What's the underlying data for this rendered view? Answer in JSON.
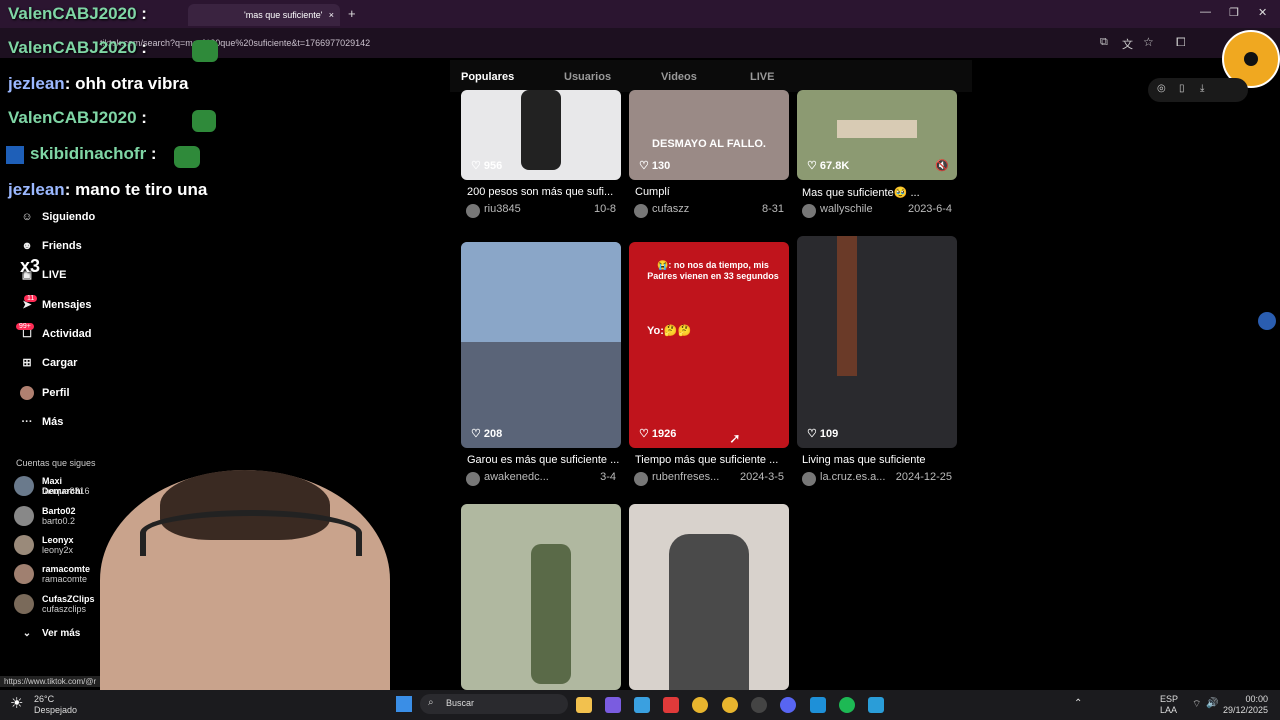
{
  "browser": {
    "tab_title": "'mas que suficiente'",
    "url": "tiktok.com/search?q=mas%20que%20suficiente&t=1766977029142",
    "new_tab": "+",
    "close": "×"
  },
  "tabs": [
    {
      "label": "Populares",
      "active": true
    },
    {
      "label": "Usuarios",
      "active": false
    },
    {
      "label": "Videos",
      "active": false
    },
    {
      "label": "LIVE",
      "active": false
    }
  ],
  "sidebar": {
    "items": [
      {
        "label": "Siguiendo",
        "icon": "people-icon"
      },
      {
        "label": "Friends",
        "icon": "friends-icon"
      },
      {
        "label": "LIVE",
        "icon": "live-icon"
      },
      {
        "label": "Mensajes",
        "icon": "send-icon",
        "badge": "11"
      },
      {
        "label": "Actividad",
        "icon": "inbox-icon",
        "badge": "99+"
      },
      {
        "label": "Cargar",
        "icon": "upload-icon"
      },
      {
        "label": "Perfil",
        "icon": "avatar"
      },
      {
        "label": "Más",
        "icon": "more-icon"
      }
    ],
    "following_title": "Cuentas que sigues",
    "following": [
      {
        "name": "Maxi Demarchi",
        "handle": "tanque8316",
        "color": "#6a7a8c"
      },
      {
        "name": "Barto02",
        "handle": "barto0.2",
        "color": "#888"
      },
      {
        "name": "Leonyx",
        "handle": "leony2x",
        "color": "#9a8a7a"
      },
      {
        "name": "ramacomte",
        "handle": "ramacomte",
        "color": "#a08070"
      },
      {
        "name": "CufasZClips",
        "handle": "cufaszclips",
        "color": "#7a6a5a"
      }
    ],
    "see_more": "Ver más"
  },
  "chat": [
    {
      "user": "ValenCABJ2020",
      "text": ":"
    },
    {
      "user": "ValenCABJ2020",
      "text": ":"
    },
    {
      "user": "jezlean",
      "text": ": ohh otra vibra"
    },
    {
      "user": "ValenCABJ2020",
      "text": ":"
    },
    {
      "user": "skibidinachofr",
      "text": ":"
    },
    {
      "user": "jezlean",
      "text": ": mano te tiro una"
    }
  ],
  "chat_badge": "x3",
  "videos": [
    {
      "likes": "956",
      "title": "200 pesos son más que sufi...",
      "author": "riu3845",
      "date": "10-8",
      "bg": "#e8e8ea"
    },
    {
      "likes": "130",
      "title": "Cumplí",
      "author": "cufaszz",
      "date": "8-31",
      "bg": "#9a8a86",
      "overlay": "DESMAYO AL FALLO."
    },
    {
      "likes": "67.8K",
      "title": "Mas que suficiente🥹 ...",
      "author": "wallyschile",
      "date": "2023-6-4",
      "bg": "#8c9a72"
    },
    {
      "likes": "208",
      "title": "Garou es más que suficiente ...",
      "author": "awakenedc...",
      "date": "3-4",
      "bg": "#5a6478"
    },
    {
      "likes": "1926",
      "title": "Tiempo más que suficiente ...",
      "author": "rubenfreses...",
      "date": "2024-3-5",
      "bg": "#c0141c",
      "overlay": "😭: no nos da tiempo, mis Padres vienen en 33 segundos",
      "overlay2": "Yo:🤔🤔"
    },
    {
      "likes": "109",
      "title": "Living mas que suficiente",
      "author": "la.cruz.es.a...",
      "date": "2024-12-25",
      "bg": "#2a2a2e"
    },
    {
      "likes": "",
      "title": "",
      "author": "",
      "date": "",
      "bg": "#b0b8a0"
    },
    {
      "likes": "",
      "title": "",
      "author": "",
      "date": "",
      "bg": "#d8d2cc"
    }
  ],
  "statusbar_url": "https://www.tiktok.com/@r",
  "taskbar": {
    "weather_temp": "26°C",
    "weather_desc": "Despejado",
    "search": "Buscar",
    "lang": "ESP",
    "region": "LAA",
    "time": "00:00",
    "date": "29/12/2025"
  }
}
